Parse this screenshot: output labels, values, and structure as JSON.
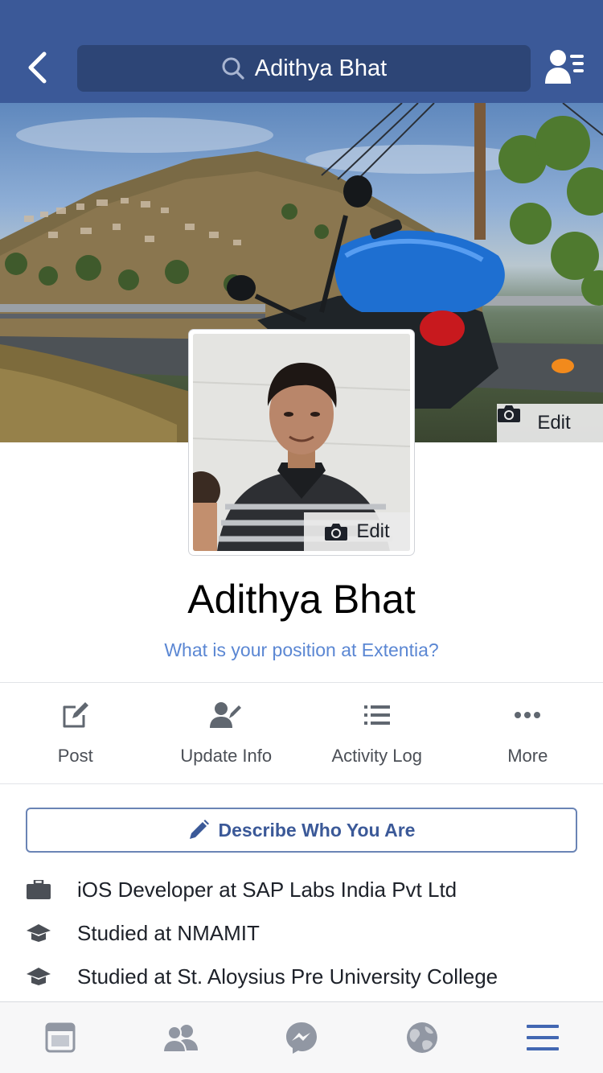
{
  "header": {
    "search_text": "Adithya Bhat",
    "icons": {
      "back": "chevron-left-icon",
      "search": "search-icon",
      "friends": "friend-requests-icon"
    }
  },
  "cover": {
    "edit_label": "Edit",
    "icon": "camera-icon"
  },
  "profile_picture": {
    "edit_label": "Edit",
    "icon": "camera-icon"
  },
  "profile": {
    "name": "Adithya Bhat",
    "position_prompt": "What is your position at Extentia?"
  },
  "actions": [
    {
      "label": "Post",
      "icon": "compose-icon"
    },
    {
      "label": "Update Info",
      "icon": "edit-profile-icon"
    },
    {
      "label": "Activity Log",
      "icon": "list-icon"
    },
    {
      "label": "More",
      "icon": "more-dots-icon"
    }
  ],
  "describe": {
    "label": "Describe Who You Are",
    "icon": "pencil-icon"
  },
  "info": [
    {
      "text": "iOS Developer at SAP Labs India Pvt Ltd",
      "icon": "briefcase-icon"
    },
    {
      "text": "Studied at NMAMIT",
      "icon": "education-icon"
    },
    {
      "text": "Studied at St. Aloysius Pre University College",
      "icon": "education-icon"
    }
  ],
  "tabbar": [
    {
      "name": "news-feed",
      "icon": "news-feed-icon",
      "active": false
    },
    {
      "name": "friends",
      "icon": "friends-icon",
      "active": false
    },
    {
      "name": "messenger",
      "icon": "messenger-icon",
      "active": false
    },
    {
      "name": "notifications",
      "icon": "globe-icon",
      "active": false
    },
    {
      "name": "menu",
      "icon": "menu-icon",
      "active": true
    }
  ],
  "colors": {
    "brand": "#3b5998",
    "search_bg": "#2d4576",
    "link": "#5b87d3",
    "tab_active": "#4267b2",
    "tab_inactive": "#9197a3"
  }
}
